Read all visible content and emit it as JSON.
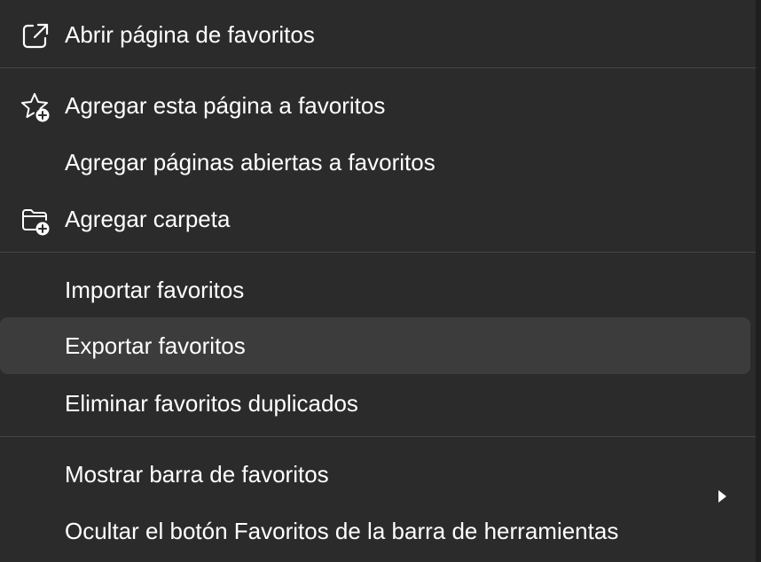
{
  "menu": {
    "items": [
      {
        "label": "Abrir página de favoritos",
        "icon": "open-external-icon"
      },
      {
        "label": "Agregar esta página a favoritos",
        "icon": "star-add-icon"
      },
      {
        "label": "Agregar páginas abiertas a favoritos"
      },
      {
        "label": "Agregar carpeta",
        "icon": "folder-add-icon"
      },
      {
        "label": "Importar favoritos"
      },
      {
        "label": "Exportar favoritos",
        "state": "hovered"
      },
      {
        "label": "Eliminar favoritos duplicados"
      },
      {
        "label": "Mostrar barra de favoritos",
        "submenu_icon": "chevron-right-icon"
      },
      {
        "label": "Ocultar el botón Favoritos de la barra de herramientas"
      }
    ]
  },
  "colors": {
    "menu_background": "#2b2b2b",
    "hover_background": "#3c3c3c",
    "text": "#ffffff",
    "divider": "#454545",
    "page_background": "#1f1f1f"
  }
}
